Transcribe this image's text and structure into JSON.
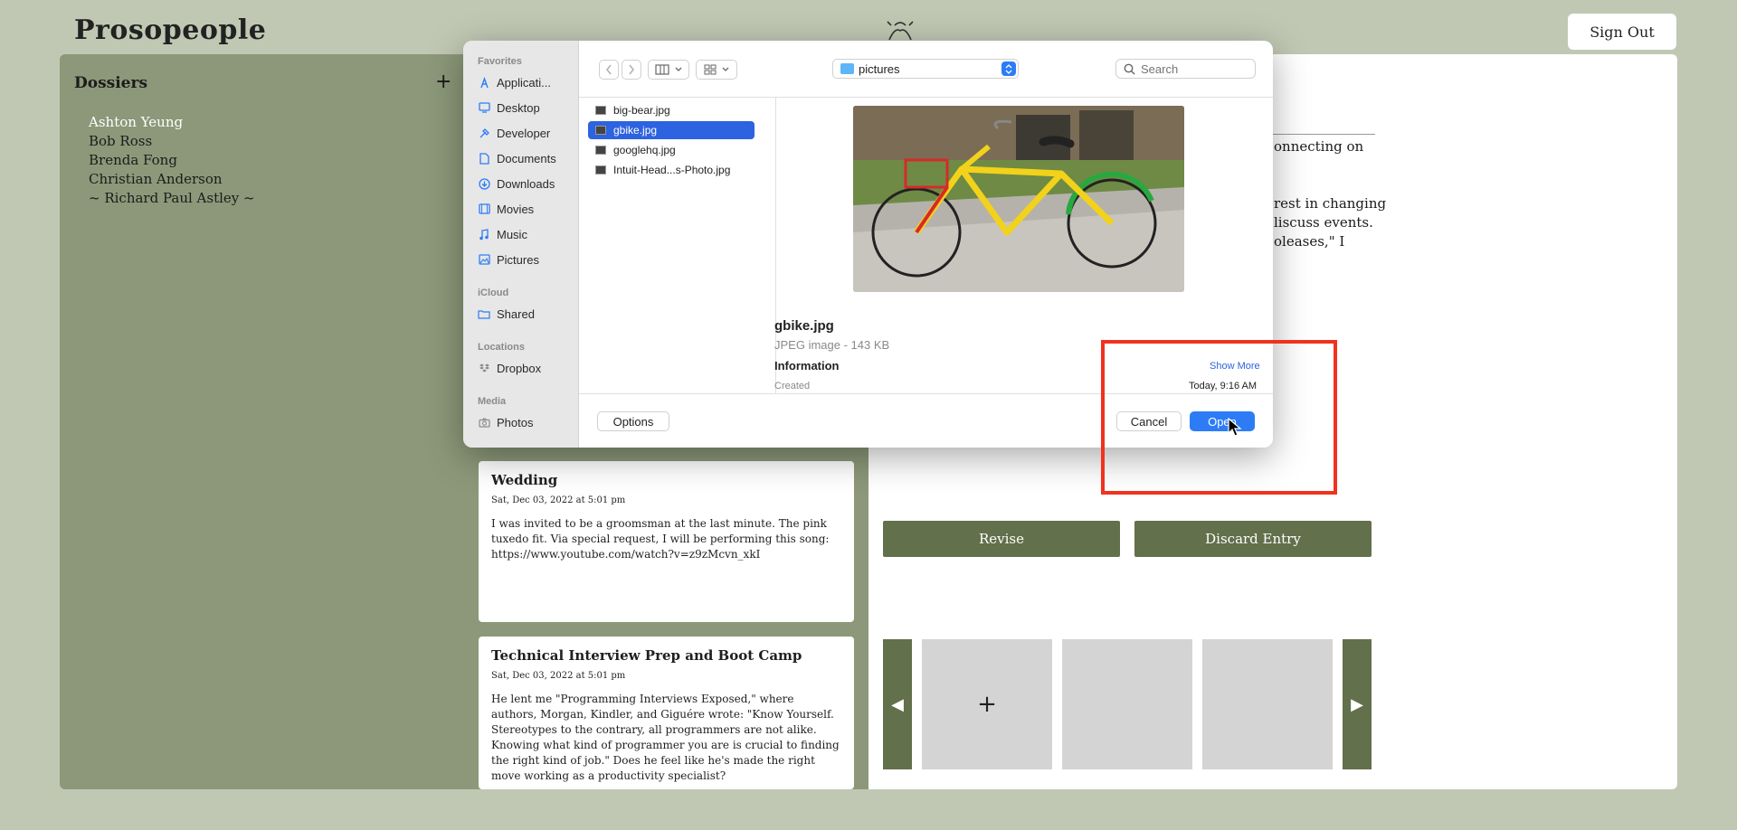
{
  "app": {
    "logo": "Prosopeople",
    "sign_out": "Sign Out"
  },
  "dossiers": {
    "title": "Dossiers",
    "add": "+",
    "items": [
      "Ashton Yeung",
      "Bob Ross",
      "Brenda Fong",
      "Christian Anderson",
      "~ Richard Paul Astley ~"
    ],
    "active_index": 0
  },
  "entries": [
    {
      "title": "Wedding",
      "date": "Sat, Dec 03, 2022 at 5:01 pm",
      "body": "I was invited to be a groomsman at the last minute. The pink tuxedo fit. Via special request, I will be performing this song: https://www.youtube.com/watch?v=z9zMcvn_xkI"
    },
    {
      "title": "Technical Interview Prep and Boot Camp",
      "date": "Sat, Dec 03, 2022 at 5:01 pm",
      "body": "He lent me \"Programming Interviews Exposed,\" where authors, Morgan, Kindler, and Giguére wrote: \"Know Yourself. Stereotypes to the contrary, all programmers are not alike. Knowing what kind of programmer you are is crucial to finding the right kind of job.\" Does he feel like he's made the right move working as a productivity specialist?"
    }
  ],
  "detail": {
    "fragments": [
      "onnecting on",
      "rest in changing",
      "liscuss events.",
      "oleases,\" I"
    ],
    "revise": "Revise",
    "discard": "Discard Entry",
    "carousel": {
      "prev": "◀",
      "next": "▶",
      "add": "+"
    }
  },
  "dialog": {
    "sidebar": {
      "favorites_label": "Favorites",
      "favorites": [
        {
          "label": "Applicati...",
          "icon": "applications-icon"
        },
        {
          "label": "Desktop",
          "icon": "desktop-icon"
        },
        {
          "label": "Developer",
          "icon": "developer-icon"
        },
        {
          "label": "Documents",
          "icon": "documents-icon"
        },
        {
          "label": "Downloads",
          "icon": "downloads-icon"
        },
        {
          "label": "Movies",
          "icon": "movies-icon"
        },
        {
          "label": "Music",
          "icon": "music-icon"
        },
        {
          "label": "Pictures",
          "icon": "pictures-icon"
        }
      ],
      "icloud_label": "iCloud",
      "icloud": [
        {
          "label": "Shared",
          "icon": "shared-folder-icon"
        }
      ],
      "locations_label": "Locations",
      "locations": [
        {
          "label": "Dropbox",
          "icon": "dropbox-icon"
        }
      ],
      "media_label": "Media",
      "media": [
        {
          "label": "Photos",
          "icon": "camera-icon"
        }
      ]
    },
    "path": "pictures",
    "search_placeholder": "Search",
    "files": [
      "big-bear.jpg",
      "gbike.jpg",
      "googlehq.jpg",
      "Intuit-Head...s-Photo.jpg"
    ],
    "selected_file_index": 1,
    "preview": {
      "name": "gbike.jpg",
      "type": "JPEG image - 143 KB",
      "info_label": "Information",
      "show_more": "Show More",
      "created_label": "Created",
      "created_value": "Today, 9:16 AM"
    },
    "options": "Options",
    "cancel": "Cancel",
    "open": "Open"
  },
  "colors": {
    "page_bg": "#c0c8b3",
    "panel_green": "#8c9879",
    "button_green": "#62704b",
    "accent_blue": "#2d7cf6",
    "selection_blue": "#2d62e0",
    "highlight_red": "#f0321e"
  }
}
